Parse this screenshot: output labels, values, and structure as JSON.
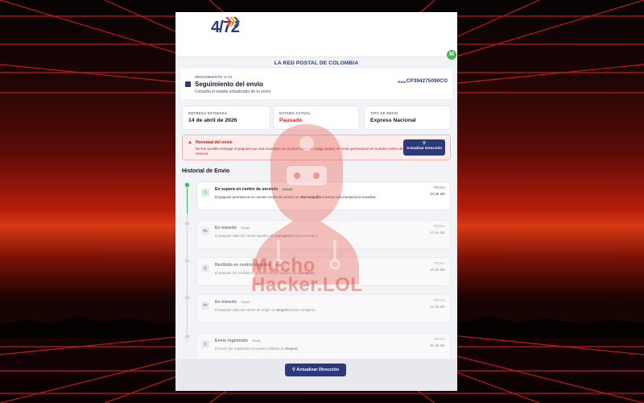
{
  "brand": {
    "logo_main": "4/72",
    "tagline": "LA RED POSTAL DE COLOMBIA",
    "ext_badge": "M"
  },
  "tracking": {
    "kicker": "SEGUIMIENTO 4-72",
    "title": "Seguimiento del envío",
    "subtitle": "Consulta el estado actualizado de tu envío",
    "guia_label": "Guía",
    "guia_number": "CP394275090CO"
  },
  "stats": [
    {
      "label": "ENTREGA ESTIMADA",
      "value": "14 de abril de 2026"
    },
    {
      "label": "ESTADO ACTUAL",
      "value": "Pausado"
    },
    {
      "label": "TIPO DE ENVÍO",
      "value": "Express Nacional"
    }
  ],
  "alert": {
    "title": "Novedad del envío",
    "text": "No fue posible entregar el paquete por una novedad con la dirección o el código postal. El envío permanece en nuestro centro de servicio.",
    "button_label": "Actualizar Dirección"
  },
  "history": {
    "title": "Historial de Envío",
    "date_label": "FECHA",
    "events": [
      {
        "title": "En espera en centro de servicio",
        "badge": "Actual",
        "text_before": "El paquete permanece en nuestro centro de servicio en ",
        "place": "Barranquilla",
        "text_after": " mientras solucionamos la novedad.",
        "date": "13 de abr"
      },
      {
        "title": "En tránsito",
        "badge": "Pend.",
        "text_before": "El paquete salió del centro logístico de ",
        "place": "Cartagena",
        "text_after": " hacia su destino.",
        "date": "13 de abr"
      },
      {
        "title": "Recibido en centro logístico",
        "badge": "Pend.",
        "text_before": "El paquete fue recibido en nuestro centro logístico de ",
        "place": "Cartagena",
        "text_after": ".",
        "date": "12 de abr"
      },
      {
        "title": "En tránsito",
        "badge": "Pend.",
        "text_before": "El paquete salió del centro de origen en ",
        "place": "Bogotá",
        "text_after": " hacia Cartagena.",
        "date": "12 de abr"
      },
      {
        "title": "Envío registrado",
        "badge": "Pend.",
        "text_before": "El envío fue registrado en nuestro sistema en ",
        "place": "Bogotá",
        "text_after": ".",
        "date": "10 de abr"
      }
    ]
  },
  "footer": {
    "button_label": "Actualizar Dirección"
  },
  "watermark": {
    "line1": "Mucho",
    "line2": "Hacker.LOL"
  },
  "colors": {
    "brand": "#2b3a7a",
    "danger": "#dc2626",
    "success": "#3fb950"
  }
}
